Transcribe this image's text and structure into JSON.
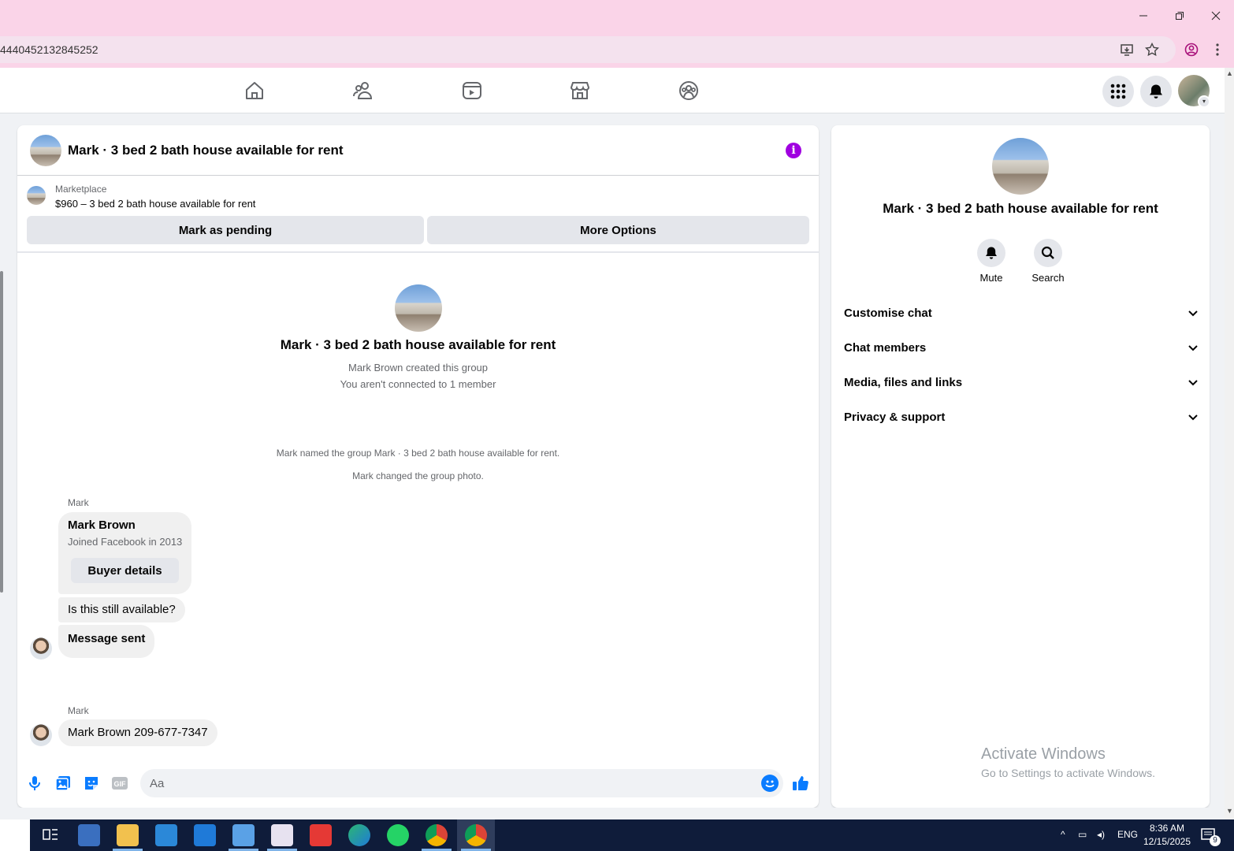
{
  "browser": {
    "url_fragment": "4440452132845252",
    "window_controls": [
      "minimize-icon",
      "restore-icon",
      "close-icon"
    ],
    "addr_icons": [
      "install-app-icon",
      "star-icon",
      "profile-icon",
      "kebab-menu-icon"
    ]
  },
  "fb_nav": {
    "tabs": [
      "home-icon",
      "friends-icon",
      "video-icon",
      "marketplace-icon",
      "groups-icon"
    ],
    "right_buttons": [
      "menu-grid-icon",
      "bell-icon",
      "account-avatar"
    ]
  },
  "chat": {
    "title": "Mark · 3 bed 2 bath house available for rent",
    "marketplace_label": "Marketplace",
    "listing": "$960 – 3 bed 2 bath house available for rent",
    "mark_pending_label": "Mark as pending",
    "more_options_label": "More Options",
    "intro": {
      "title": "Mark · 3 bed 2 bath house available for rent",
      "created": "Mark Brown created this group",
      "connection": "You aren't connected to 1 member"
    },
    "system_messages": [
      "Mark named the group Mark · 3 bed 2 bath house available for rent.",
      "Mark changed the group photo."
    ],
    "messages": {
      "sender1": "Mark",
      "card_name": "Mark Brown",
      "card_joined": "Joined Facebook in 2013",
      "buyer_details_label": "Buyer details",
      "msg1": "Is this still available?",
      "msg2": "Message sent",
      "sender2": "Mark",
      "msg3": "Mark Brown 209-677-7347"
    },
    "composer": {
      "placeholder": "Aa"
    }
  },
  "side_panel": {
    "title": "Mark · 3 bed 2 bath house available for rent",
    "actions": [
      {
        "label": "Mute"
      },
      {
        "label": "Search"
      }
    ],
    "sections": [
      "Customise chat",
      "Chat members",
      "Media, files and links",
      "Privacy & support"
    ]
  },
  "watermark": {
    "line1": "Activate Windows",
    "line2": "Go to Settings to activate Windows."
  },
  "taskbar": {
    "lang": "ENG",
    "time": "8:36 AM",
    "date": "12/15/2025",
    "notifications": "9"
  },
  "colors": {
    "accent": "#0a7cff",
    "info": "#a000e0",
    "browser_chrome": "#fad4e8",
    "taskbar": "#0f1c3a"
  }
}
